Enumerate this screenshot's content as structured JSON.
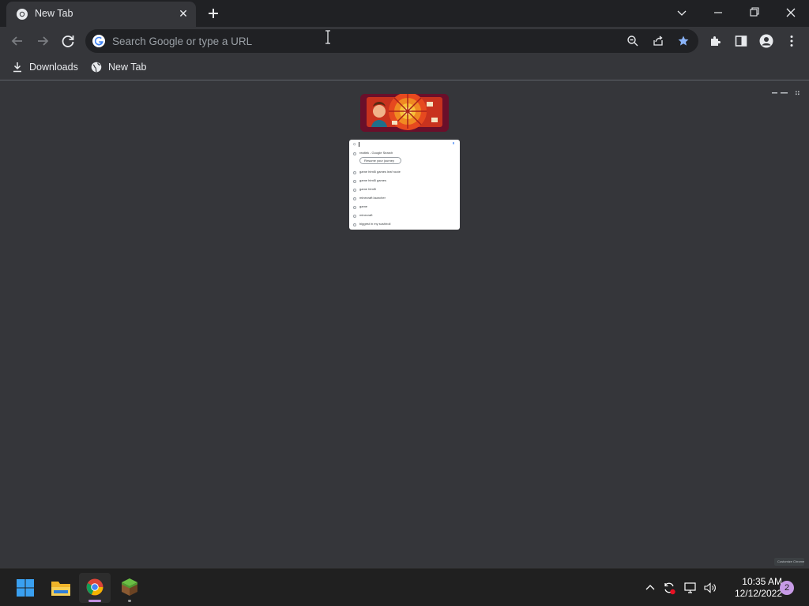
{
  "browser": {
    "tab": {
      "title": "New Tab",
      "close_glyph": "✕"
    },
    "new_tab_icon": "plus-icon",
    "window_controls": [
      "chevron-down-icon",
      "minimize-icon",
      "restore-icon",
      "close-icon"
    ],
    "omnibox": {
      "placeholder": "Search Google or type a URL"
    },
    "toolbar_icons": [
      "back-icon",
      "forward-icon",
      "reload-icon",
      "zoom-icon",
      "share-icon",
      "star-icon",
      "extensions-icon",
      "side-panel-icon",
      "profile-icon",
      "menu-icon"
    ],
    "bookmarks": [
      {
        "label": "Downloads",
        "icon": "download-icon"
      },
      {
        "label": "New Tab",
        "icon": "globe-icon"
      }
    ]
  },
  "ntp": {
    "suggestions_header": "Resume your journey",
    "suggestions": [
      "realtek - Google Search",
      "game html5 games leaf route",
      "game html5 games",
      "game html5",
      "minecraft launcher",
      "game",
      "minecraft",
      "biggest in my sushiroll"
    ],
    "customize_label": "Customize Chrome"
  },
  "taskbar": {
    "apps": [
      "windows-start-icon",
      "file-explorer-icon",
      "chrome-icon",
      "minecraft-icon"
    ],
    "time": "10:35 AM",
    "date": "12/12/2022",
    "notification_count": "2"
  },
  "colors": {
    "accent": "#8ab4f8",
    "star": "#8ab4f8",
    "notification": "#c79be6"
  }
}
